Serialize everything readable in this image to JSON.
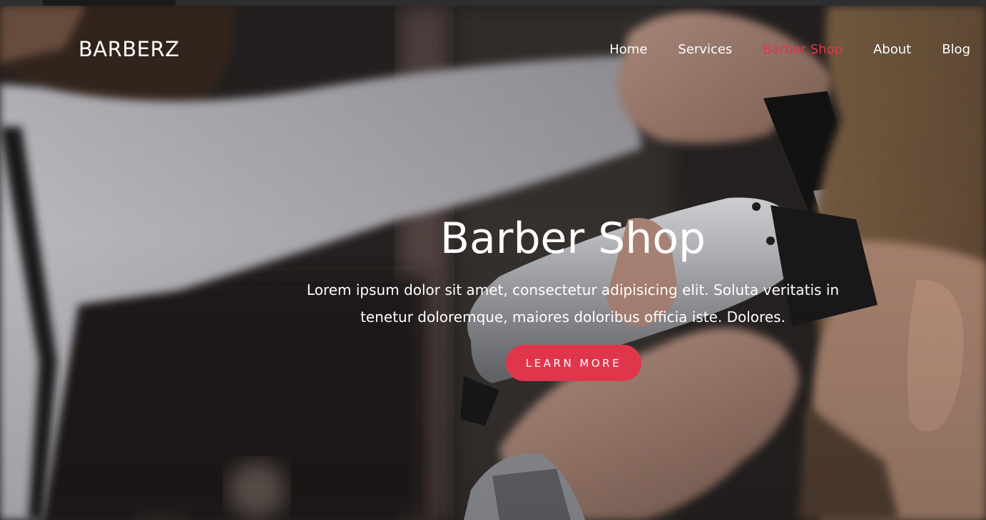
{
  "brand": {
    "logo": "BARBERZ"
  },
  "nav": {
    "items": [
      {
        "label": "Home",
        "active": false
      },
      {
        "label": "Services",
        "active": false
      },
      {
        "label": "Barber Shop",
        "active": true
      },
      {
        "label": "About",
        "active": false
      },
      {
        "label": "Blog",
        "active": false
      }
    ]
  },
  "hero": {
    "title": "Barber Shop",
    "text": "Lorem ipsum dolor sit amet, consectetur adipisicing elit. Soluta veritatis in tenetur doloremque, maiores doloribus officia iste. Dolores.",
    "cta_label": "LEARN MORE",
    "background_image": "barber-cutting-hair-photo"
  },
  "colors": {
    "accent": "#e0364c",
    "text": "#ffffff"
  }
}
